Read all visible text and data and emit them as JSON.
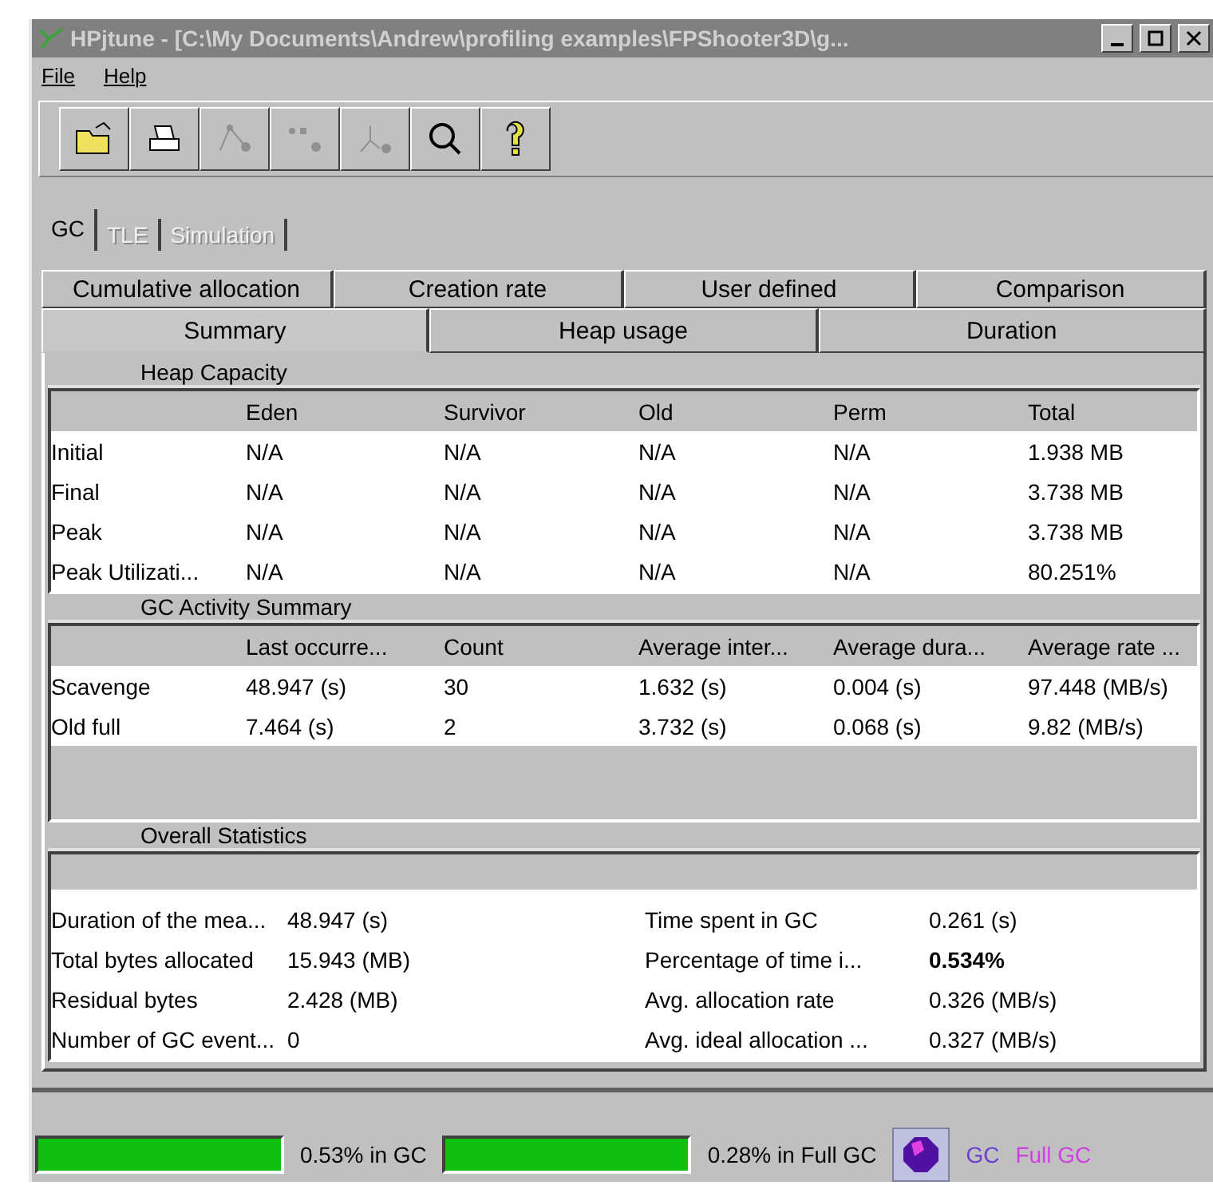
{
  "window": {
    "title": "HPjtune - [C:\\My Documents\\Andrew\\profiling examples\\FPShooter3D\\g..."
  },
  "menu": [
    "File",
    "Help"
  ],
  "toolbar": [
    {
      "kind": "open",
      "disabled": false
    },
    {
      "kind": "print",
      "disabled": false
    },
    {
      "kind": "graph",
      "disabled": true
    },
    {
      "kind": "dots",
      "disabled": true
    },
    {
      "kind": "fork",
      "disabled": true
    },
    {
      "kind": "search",
      "disabled": false
    },
    {
      "kind": "help",
      "disabled": false
    }
  ],
  "main_tabs": [
    {
      "label": "GC",
      "selected": true,
      "disabled": false
    },
    {
      "label": "TLE",
      "selected": false,
      "disabled": true
    },
    {
      "label": "Simulation",
      "selected": false,
      "disabled": true
    }
  ],
  "sub_tabs_back": [
    {
      "label": "Cumulative allocation",
      "selected": false
    },
    {
      "label": "Creation rate",
      "selected": false
    },
    {
      "label": "User defined",
      "selected": false
    },
    {
      "label": "Comparison",
      "selected": false
    }
  ],
  "sub_tabs_front": [
    {
      "label": "Summary",
      "selected": true
    },
    {
      "label": "Heap usage",
      "selected": false
    },
    {
      "label": "Duration",
      "selected": false
    }
  ],
  "heap_capacity": {
    "title": "Heap Capacity",
    "columns": [
      "",
      "Eden",
      "Survivor",
      "Old",
      "Perm",
      "Total"
    ],
    "rows": [
      [
        "Initial",
        "N/A",
        "N/A",
        "N/A",
        "N/A",
        "1.938 MB"
      ],
      [
        "Final",
        "N/A",
        "N/A",
        "N/A",
        "N/A",
        "3.738 MB"
      ],
      [
        "Peak",
        "N/A",
        "N/A",
        "N/A",
        "N/A",
        "3.738 MB"
      ],
      [
        "Peak Utilizati...",
        "N/A",
        "N/A",
        "N/A",
        "N/A",
        "80.251%"
      ]
    ]
  },
  "gc_activity": {
    "title": "GC Activity Summary",
    "columns": [
      "",
      "Last occurre...",
      "Count",
      "Average inter...",
      "Average dura...",
      "Average rate ..."
    ],
    "rows": [
      [
        "Scavenge",
        "48.947 (s)",
        "30",
        "1.632 (s)",
        "0.004 (s)",
        "97.448 (MB/s)"
      ],
      [
        "Old full",
        "7.464 (s)",
        "2",
        "3.732 (s)",
        "0.068 (s)",
        "9.82 (MB/s)"
      ]
    ]
  },
  "overall": {
    "title": "Overall Statistics",
    "rows": [
      [
        "Duration of the mea...",
        "48.947 (s)",
        "Time spent in GC",
        "0.261 (s)"
      ],
      [
        "Total bytes allocated",
        "15.943 (MB)",
        "Percentage of time i...",
        "**0.534%**"
      ],
      [
        "Residual bytes",
        "2.428 (MB)",
        "Avg. allocation rate",
        "0.326 (MB/s)"
      ],
      [
        "Number of GC event...",
        "0",
        "Avg. ideal allocation ...",
        "0.327 (MB/s)"
      ]
    ]
  },
  "status": {
    "meters": [
      {
        "level": 1,
        "reading": "0.53% in GC"
      },
      {
        "level": 1,
        "reading": "0.28% in Full GC"
      }
    ],
    "legend": [
      {
        "label": "GC",
        "color": "#6a3fd0"
      },
      {
        "label": "Full GC",
        "color": "#d040e0"
      }
    ]
  }
}
